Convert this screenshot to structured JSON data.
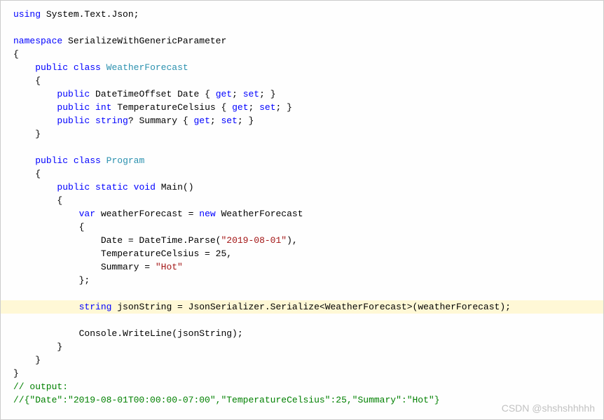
{
  "tokens": {
    "using": "using",
    "namespace": "namespace",
    "public": "public",
    "class": "class",
    "static": "static",
    "void": "void",
    "var": "var",
    "new": "new",
    "string": "string",
    "int": "int",
    "get": "get",
    "set": "set"
  },
  "identifiers": {
    "systemTextJson": "System.Text.Json",
    "namespaceName": "SerializeWithGenericParameter",
    "weatherForecast": "WeatherForecast",
    "dateTimeOffset": "DateTimeOffset",
    "program": "Program",
    "main": "Main",
    "dateProp": " Date { ",
    "tempProp": " TemperatureCelsius { ",
    "summaryProp": "? Summary { ",
    "weatherVar": " weatherForecast = ",
    "dateAssign": "Date = DateTime.Parse(",
    "tempAssign": "TemperatureCelsius = 25,",
    "summaryAssign": "Summary = ",
    "jsonStringVar": " jsonString = JsonSerializer.Serialize<",
    "serializeEnd": ">(weatherForecast);",
    "consoleWrite": "Console.WriteLine(jsonString);"
  },
  "strings": {
    "date": "\"2019-08-01\"",
    "hot": "\"Hot\""
  },
  "comments": {
    "output": "// output:",
    "outputJson": "//{\"Date\":\"2019-08-01T00:00:00-07:00\",\"TemperatureCelsius\":25,\"Summary\":\"Hot\"}"
  },
  "punct": {
    "semicolon": ";",
    "obrace": "{",
    "cbrace": "}",
    "cbraceSemi": "};",
    "closeAccessor": "; }",
    "parens": "()",
    "closeParenComma": "),"
  },
  "watermark": "CSDN @shshshhhhh"
}
